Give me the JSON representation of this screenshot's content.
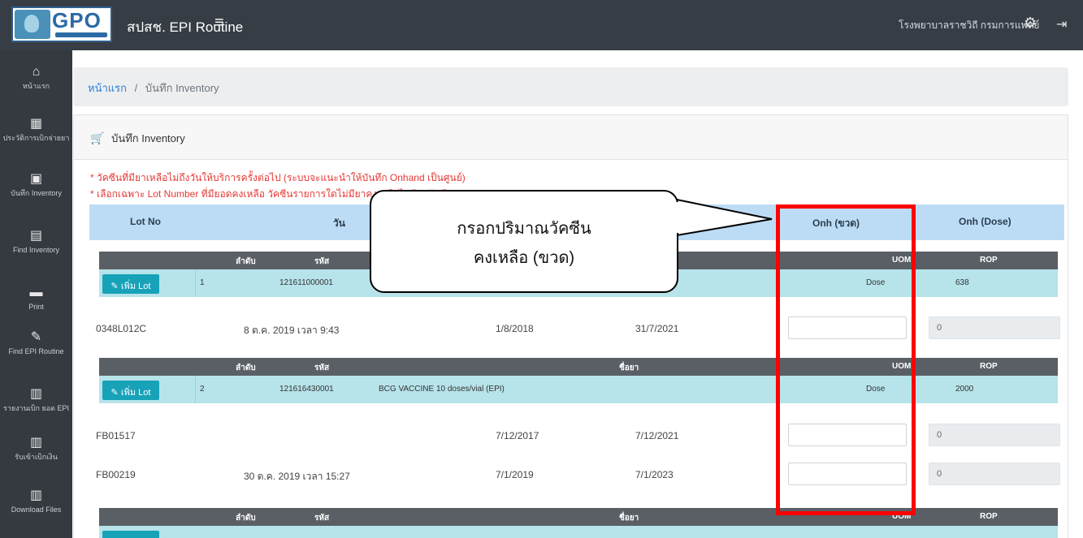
{
  "header": {
    "logo_text": "GPO",
    "brand": "สปสช. EPI Routine",
    "menu_icon": "≡",
    "org_name": "โรงพยาบาลราชวิถี กรมการแพทย์"
  },
  "sidebar": {
    "items": [
      {
        "icon": "home-icon",
        "glyph": "⌂",
        "label": "หน้าแรก"
      },
      {
        "icon": "service-icon",
        "glyph": "▦",
        "label": "ประวัติการเบิกจ่ายยา"
      },
      {
        "icon": "inventory-icon",
        "glyph": "▣",
        "label": "บันทึก Inventory"
      },
      {
        "icon": "find-inventory-icon",
        "glyph": "▤",
        "label": "Find Inventory"
      },
      {
        "icon": "print-icon",
        "glyph": "▬",
        "label": "Print"
      },
      {
        "icon": "find-epi-icon",
        "glyph": "✎",
        "label": "Find EPI Routine"
      },
      {
        "icon": "report-icon",
        "glyph": "▥",
        "label": "รายงานเบิก ยอด EPI"
      },
      {
        "icon": "report2-icon",
        "glyph": "▥",
        "label": "รับเข้าเบิกเงิน"
      },
      {
        "icon": "download-icon",
        "glyph": "▥",
        "label": "Download Files"
      }
    ]
  },
  "breadcrumb": {
    "home": "หน้าแรก",
    "separator": "/",
    "current": "บันทึก Inventory"
  },
  "card": {
    "title": "บันทึก Inventory",
    "notes": [
      "* วัคซีนที่มียาเหลือไม่ถึงวันให้บริการครั้งต่อไป (ระบบจะแนะนำให้บันทึก Onhand เป็นศูนย์)",
      "* เลือกเฉพาะ Lot Number ที่มียอดคงเหลือ วัคซีนรายการใดไม่มียาคงเหลือไม่ต้องบันทึก"
    ]
  },
  "table": {
    "headers": {
      "lot": "Lot No",
      "date": "วัน",
      "onh_vial": "Onh (ขวด)",
      "onh_dose": "Onh (Dose)"
    },
    "group_headers": {
      "seq": "ลำดับ",
      "code": "รหัส",
      "name": "ชื่อยา",
      "unit": "UOM",
      "rop": "ROP"
    },
    "add_lot_label": "✎ เพิ่ม Lot",
    "groups": [
      {
        "seq": "1",
        "code": "121611000001",
        "name": "",
        "unit": "Dose",
        "rop": "638",
        "lots": [
          {
            "lot": "0348L012C",
            "received": "8 ต.ค. 2019 เวลา 9:43",
            "mfg": "1/8/2018",
            "exp": "31/7/2021",
            "dose": "0"
          }
        ]
      },
      {
        "seq": "2",
        "code": "121616430001",
        "name": "BCG VACCINE 10 doses/vial (EPI)",
        "unit": "Dose",
        "rop": "2000",
        "lots": [
          {
            "lot": "FB01517",
            "received": "",
            "mfg": "7/12/2017",
            "exp": "7/12/2021",
            "dose": "0"
          },
          {
            "lot": "FB00219",
            "received": "30 ต.ค. 2019 เวลา 15:27",
            "mfg": "7/1/2019",
            "exp": "7/1/2023",
            "dose": "0"
          }
        ]
      },
      {
        "seq": "",
        "code": "",
        "name": "",
        "unit": "",
        "rop": "",
        "lots": []
      }
    ]
  },
  "annotation": {
    "line1": "กรอกปริมาณวัคซีน",
    "line2": "คงเหลือ (ขวด)",
    "box_color": "#ff0000"
  }
}
